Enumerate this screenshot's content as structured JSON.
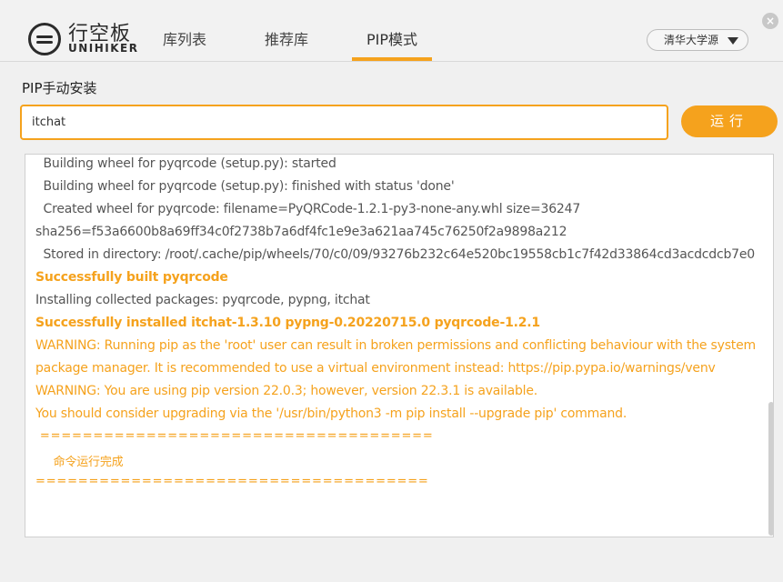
{
  "header": {
    "logo_cn": "行空板",
    "logo_en": "UNIHIKER",
    "tabs": [
      {
        "label": "库列表"
      },
      {
        "label": "推荐库"
      },
      {
        "label": "PIP模式",
        "active": true
      }
    ],
    "mirror_select": "清华大学源",
    "accent_color": "#f5a21d"
  },
  "pip": {
    "section_title": "PIP手动安装",
    "input_value": "itchat",
    "run_label": "运行"
  },
  "console": {
    "lines": [
      {
        "text": "  Building wheel for pyqrcode (setup.py): started",
        "style": "normal"
      },
      {
        "text": "  Building wheel for pyqrcode (setup.py): finished with status 'done'",
        "style": "normal"
      },
      {
        "text": "  Created wheel for pyqrcode: filename=PyQRCode-1.2.1-py3-none-any.whl size=36247",
        "style": "normal"
      },
      {
        "text": "sha256=f53a6600b8a69ff34c0f2738b7a6df4fc1e9e3a621aa745c76250f2a9898a212",
        "style": "normal"
      },
      {
        "text": "  Stored in directory: /root/.cache/pip/wheels/70/c0/09/93276b232c64e520bc19558cb1c7f42d33864cd3acdcdcb7e0",
        "style": "normal"
      },
      {
        "text": "Successfully built pyqrcode",
        "style": "bold"
      },
      {
        "text": "Installing collected packages: pyqrcode, pypng, itchat",
        "style": "normal"
      },
      {
        "text": "Successfully installed itchat-1.3.10 pypng-0.20220715.0 pyqrcode-1.2.1",
        "style": "bold"
      },
      {
        "text": "WARNING: Running pip as the 'root' user can result in broken permissions and conflicting behaviour with the system",
        "style": "warn"
      },
      {
        "text": "package manager. It is recommended to use a virtual environment instead: https://pip.pypa.io/warnings/venv",
        "style": "warn"
      },
      {
        "text": "WARNING: You are using pip version 22.0.3; however, version 22.3.1 is available.",
        "style": "warn"
      },
      {
        "text": "You should consider upgrading via the '/usr/bin/python3 -m pip install --upgrade pip' command.",
        "style": "warn"
      },
      {
        "text": " =====================================",
        "style": "warn"
      },
      {
        "text": "     命令运行完成",
        "style": "warn"
      },
      {
        "text": "=====================================",
        "style": "warn"
      }
    ]
  }
}
